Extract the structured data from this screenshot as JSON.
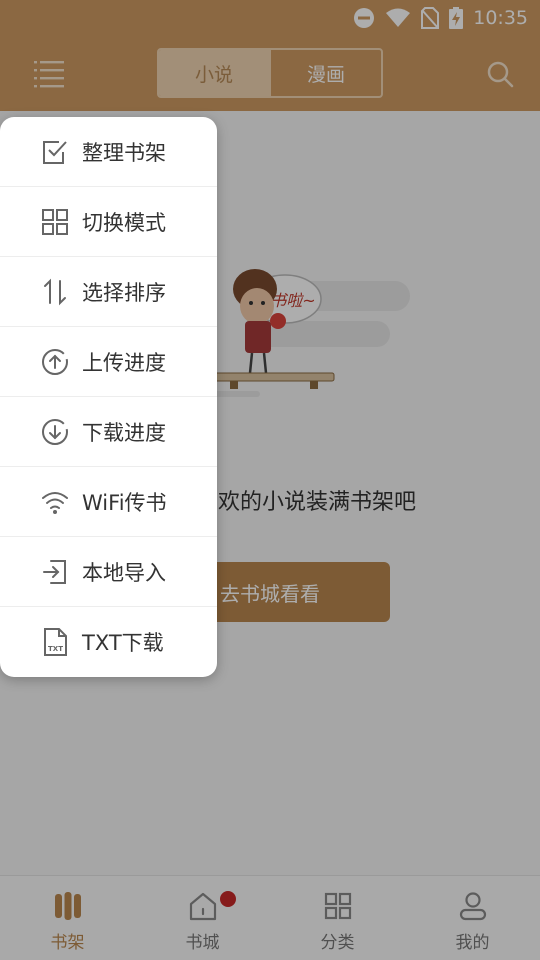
{
  "status_bar": {
    "time": "10:35"
  },
  "header": {
    "tabs": [
      {
        "label": "小说",
        "active": true
      },
      {
        "label": "漫画",
        "active": false
      }
    ],
    "accent_color": "#cd9a62"
  },
  "empty_state": {
    "bubble_text": "没书啦~",
    "message": "快把喜欢的小说装满书架吧",
    "visible_message": "欢的小说装满书架吧",
    "button_label": "去书城看看"
  },
  "popup_menu": {
    "items": [
      {
        "icon": "checkbox-icon",
        "label": "整理书架"
      },
      {
        "icon": "grid-icon",
        "label": "切换模式"
      },
      {
        "icon": "sort-icon",
        "label": "选择排序"
      },
      {
        "icon": "upload-icon",
        "label": "上传进度"
      },
      {
        "icon": "download-icon",
        "label": "下载进度"
      },
      {
        "icon": "wifi-icon",
        "label": "WiFi传书"
      },
      {
        "icon": "import-icon",
        "label": "本地导入"
      },
      {
        "icon": "txt-icon",
        "label": "TXT下载"
      }
    ]
  },
  "bottom_nav": {
    "items": [
      {
        "icon": "bookshelf-icon",
        "label": "书架",
        "active": true
      },
      {
        "icon": "store-icon",
        "label": "书城",
        "active": false
      },
      {
        "icon": "category-icon",
        "label": "分类",
        "active": false
      },
      {
        "icon": "profile-icon",
        "label": "我的",
        "active": false
      }
    ],
    "active_color": "#b8874f"
  }
}
